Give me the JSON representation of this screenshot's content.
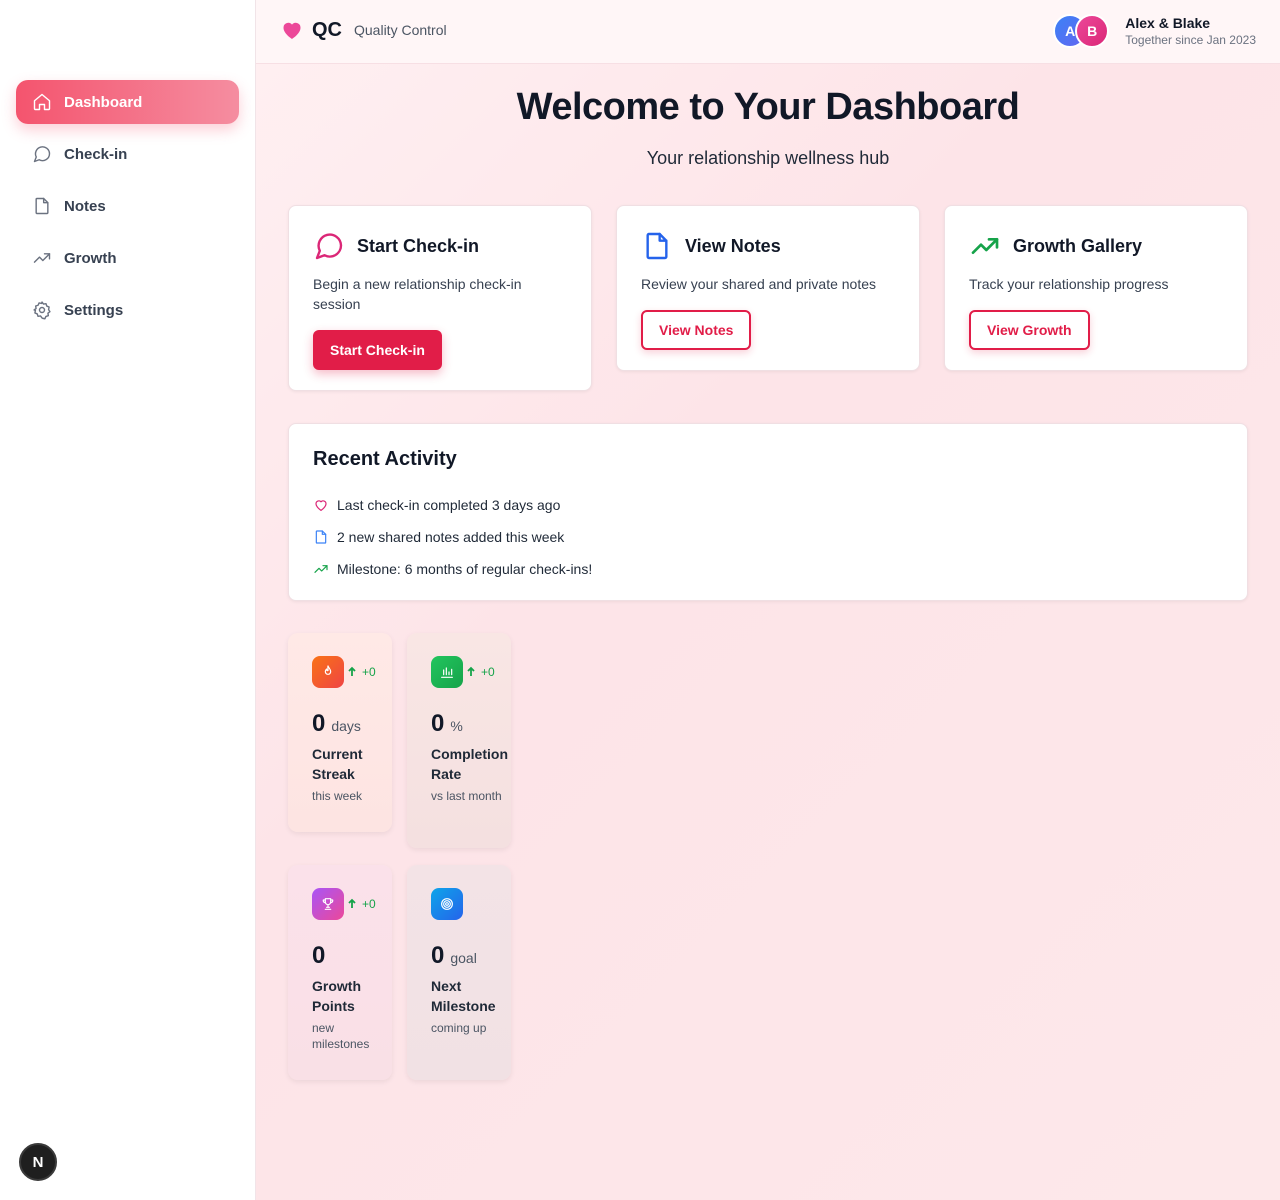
{
  "sidebar": {
    "items": [
      {
        "label": "Dashboard",
        "icon": "home-icon",
        "active": true
      },
      {
        "label": "Check-in",
        "icon": "message-circle-icon",
        "active": false
      },
      {
        "label": "Notes",
        "icon": "file-icon",
        "active": false
      },
      {
        "label": "Growth",
        "icon": "trending-up-icon",
        "active": false
      },
      {
        "label": "Settings",
        "icon": "gear-icon",
        "active": false
      }
    ],
    "badge": "N"
  },
  "header": {
    "brand": "QC",
    "brand_sub": "Quality Control",
    "avatar_a": "A",
    "avatar_b": "B",
    "user_names": "Alex & Blake",
    "user_since": "Together since Jan 2023"
  },
  "hero": {
    "title": "Welcome to Your Dashboard",
    "subtitle": "Your relationship wellness hub"
  },
  "quick_actions": [
    {
      "title": "Start Check-in",
      "desc": "Begin a new relationship check-in session",
      "button": "Start Check-in",
      "icon": "message-circle-icon",
      "color": "#db2777"
    },
    {
      "title": "View Notes",
      "desc": "Review your shared and private notes",
      "button": "View Notes",
      "icon": "file-icon",
      "color": "#2563eb"
    },
    {
      "title": "Growth Gallery",
      "desc": "Track your relationship progress",
      "button": "View Growth",
      "icon": "trending-up-icon",
      "color": "#16a34a"
    }
  ],
  "activity": {
    "title": "Recent Activity",
    "items": [
      {
        "text": "Last check-in completed 3 days ago",
        "icon": "heart-icon",
        "color": "#db2777"
      },
      {
        "text": "2 new shared notes added this week",
        "icon": "file-icon",
        "color": "#3b82f6"
      },
      {
        "text": "Milestone: 6 months of regular check-ins!",
        "icon": "trending-up-icon",
        "color": "#16a34a"
      }
    ]
  },
  "stats": [
    {
      "value": "0",
      "unit": "days",
      "label": "Current Streak",
      "note": "this week",
      "trend": "+0",
      "icon": "flame-icon"
    },
    {
      "value": "0",
      "unit": "%",
      "label": "Completion Rate",
      "note": "vs last month",
      "trend": "+0",
      "icon": "bar-chart-icon"
    },
    {
      "value": "0",
      "unit": "",
      "label": "Growth Points",
      "note": "new milestones",
      "trend": "+0",
      "icon": "trophy-icon"
    },
    {
      "value": "0",
      "unit": "goal",
      "label": "Next Milestone",
      "note": "coming up",
      "trend": "",
      "icon": "target-icon"
    }
  ],
  "colors": {
    "accent": "#e11d48",
    "nav_active_start": "#f4546e",
    "nav_active_end": "#f58da0",
    "trend_up": "#16a34a"
  }
}
